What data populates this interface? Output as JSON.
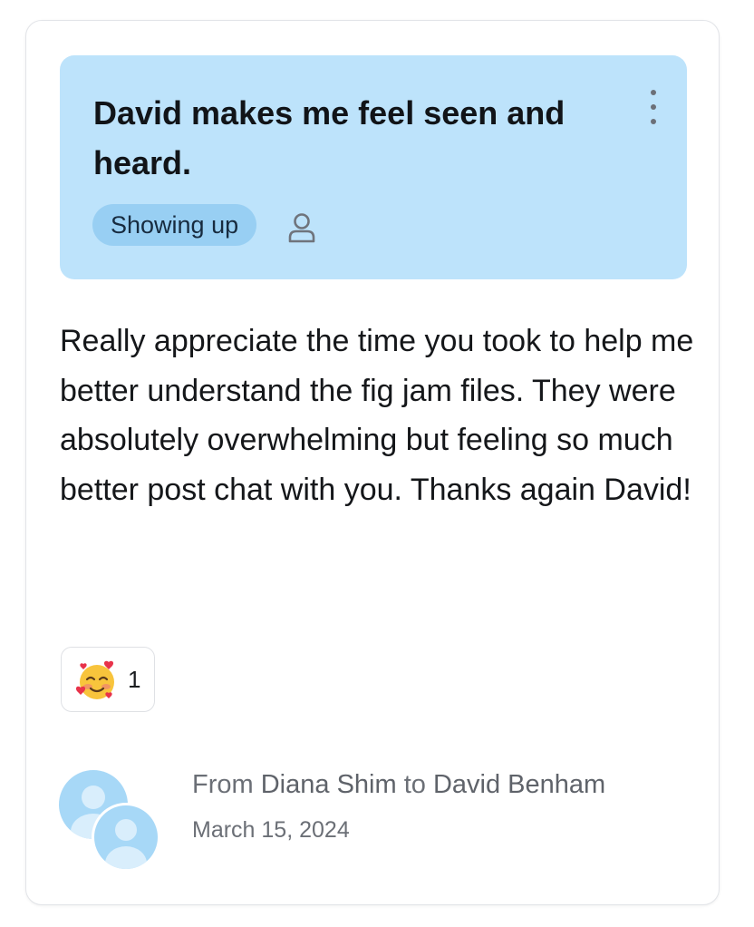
{
  "post": {
    "title": "David makes me feel seen and heard.",
    "tag": "Showing up",
    "message": "Really appreciate the time you took to help me better understand the fig jam files. They were absolutely overwhelming but feeling so much better post chat with you. Thanks again David!",
    "more_icon": "more-vertical-icon",
    "visibility_icon": "person-icon"
  },
  "reaction": {
    "emoji_icon": "smiling-face-with-hearts-emoji",
    "count": "1"
  },
  "footer": {
    "from_prefix": "From",
    "from_name": "Diana Shim",
    "to_word": "to",
    "to_name": "David Benham",
    "date": "March 15, 2024"
  },
  "colors": {
    "header_bg": "#bde3fb",
    "tag_bg": "#98cff3",
    "avatar_bg": "#a7d8f7",
    "text_primary": "#15171a",
    "text_muted": "#6b6f76"
  }
}
